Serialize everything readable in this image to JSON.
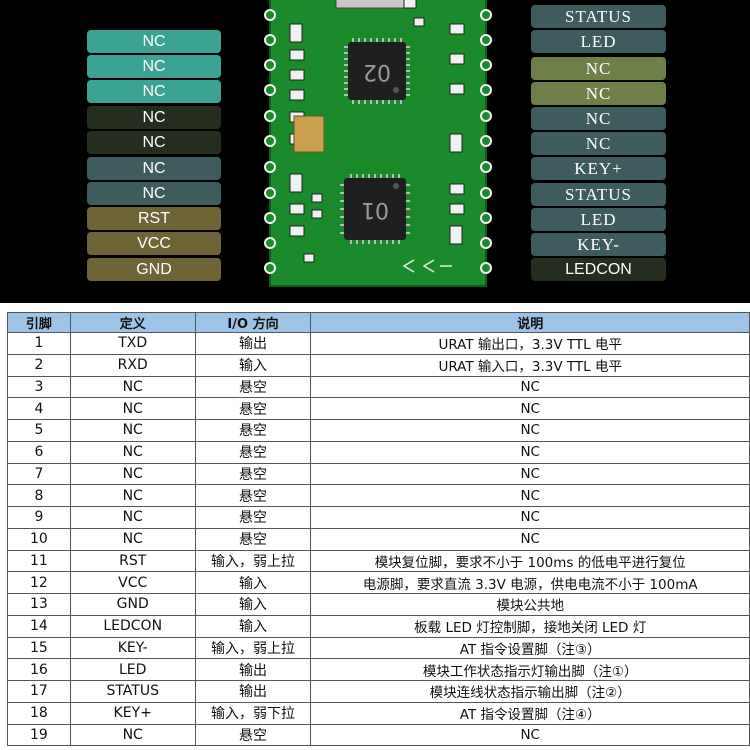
{
  "module": {
    "left_pins": [
      {
        "label": "NC",
        "color": "#3aa394"
      },
      {
        "label": "NC",
        "color": "#3aa394"
      },
      {
        "label": "NC",
        "color": "#3aa394"
      },
      {
        "label": "NC",
        "color": "#242d1e"
      },
      {
        "label": "NC",
        "color": "#242d1e"
      },
      {
        "label": "NC",
        "color": "#3e5c5d"
      },
      {
        "label": "NC",
        "color": "#3e5c5d"
      },
      {
        "label": "RST",
        "color": "#6f6436"
      },
      {
        "label": "VCC",
        "color": "#6f6436"
      },
      {
        "label": "GND",
        "color": "#6f6436"
      }
    ],
    "right_pins": [
      {
        "label": "STATUS",
        "color": "#3e5c5d"
      },
      {
        "label": "LED",
        "color": "#3e5c5d"
      },
      {
        "label": "NC",
        "color": "#6f7f48"
      },
      {
        "label": "NC",
        "color": "#6f7f48"
      },
      {
        "label": "NC",
        "color": "#3e5c5d"
      },
      {
        "label": "NC",
        "color": "#3e5c5d"
      },
      {
        "label": "KEY+",
        "color": "#3e5c5d"
      },
      {
        "label": "STATUS",
        "color": "#3e5c5d"
      },
      {
        "label": "LED",
        "color": "#3e5c5d"
      },
      {
        "label": "KEY-",
        "color": "#3e5c5d"
      },
      {
        "label": "LEDCON",
        "color": "#242d1e"
      }
    ],
    "chip_top_marking": "02",
    "chip_bottom_marking": "01",
    "pcb_color": "#1a8a2a"
  },
  "table": {
    "headers": [
      "引脚",
      "定义",
      "I/O 方向",
      "说明"
    ],
    "header_color": "#9dc3e6",
    "rows": [
      [
        "1",
        "TXD",
        "输出",
        "URAT 输出口，3.3V TTL 电平"
      ],
      [
        "2",
        "RXD",
        "输入",
        "URAT 输入口，3.3V TTL 电平"
      ],
      [
        "3",
        "NC",
        "悬空",
        "NC"
      ],
      [
        "4",
        "NC",
        "悬空",
        "NC"
      ],
      [
        "5",
        "NC",
        "悬空",
        "NC"
      ],
      [
        "6",
        "NC",
        "悬空",
        "NC"
      ],
      [
        "7",
        "NC",
        "悬空",
        "NC"
      ],
      [
        "8",
        "NC",
        "悬空",
        "NC"
      ],
      [
        "9",
        "NC",
        "悬空",
        "NC"
      ],
      [
        "10",
        "NC",
        "悬空",
        "NC"
      ],
      [
        "11",
        "RST",
        "输入，弱上拉",
        "模块复位脚，要求不小于 100ms 的低电平进行复位"
      ],
      [
        "12",
        "VCC",
        "输入",
        "电源脚，要求直流 3.3V 电源，供电电流不小于 100mA"
      ],
      [
        "13",
        "GND",
        "输入",
        "模块公共地"
      ],
      [
        "14",
        "LEDCON",
        "输入",
        "板载 LED 灯控制脚，接地关闭 LED 灯"
      ],
      [
        "15",
        "KEY-",
        "输入，弱上拉",
        "AT 指令设置脚（注③）"
      ],
      [
        "16",
        "LED",
        "输出",
        "模块工作状态指示灯输出脚（注①）"
      ],
      [
        "17",
        "STATUS",
        "输出",
        "模块连线状态指示输出脚（注②）"
      ],
      [
        "18",
        "KEY+",
        "输入，弱下拉",
        "AT 指令设置脚（注④）"
      ],
      [
        "19",
        "NC",
        "悬空",
        "NC"
      ]
    ]
  }
}
